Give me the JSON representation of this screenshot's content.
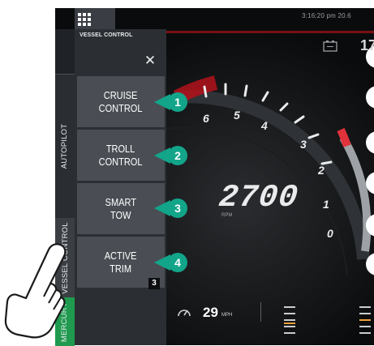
{
  "header": {
    "clock": "3:16:20 pm 20.6",
    "top_right_value": "17",
    "menu_icon": "grid-icon",
    "battery_icon": "battery-icon"
  },
  "side_tabs": [
    {
      "label": "AUTOPILOT"
    },
    {
      "label": "VESSEL CONTROL"
    },
    {
      "label": "MERCURY"
    }
  ],
  "panel": {
    "title": "VESSEL CONTROL",
    "close_icon": "close-icon",
    "items": [
      {
        "label": "CRUISE\nCONTROL",
        "callout": "1"
      },
      {
        "label": "TROLL\nCONTROL",
        "callout": "2"
      },
      {
        "label": "SMART\nTOW",
        "callout": "3"
      },
      {
        "label": "ACTIVE\nTRIM",
        "callout": "4",
        "badge": "3"
      }
    ]
  },
  "gauge": {
    "rpm_value": "2700",
    "rpm_label": "RPM",
    "tick_labels": [
      "6",
      "5",
      "4",
      "3",
      "2",
      "1",
      "0"
    ]
  },
  "speed": {
    "value": "29",
    "unit": "MPH",
    "icon": "speedometer-icon"
  },
  "colors": {
    "accent_green": "#1f9a4e",
    "callout_teal": "#12a58a",
    "redline": "#b3121b"
  }
}
